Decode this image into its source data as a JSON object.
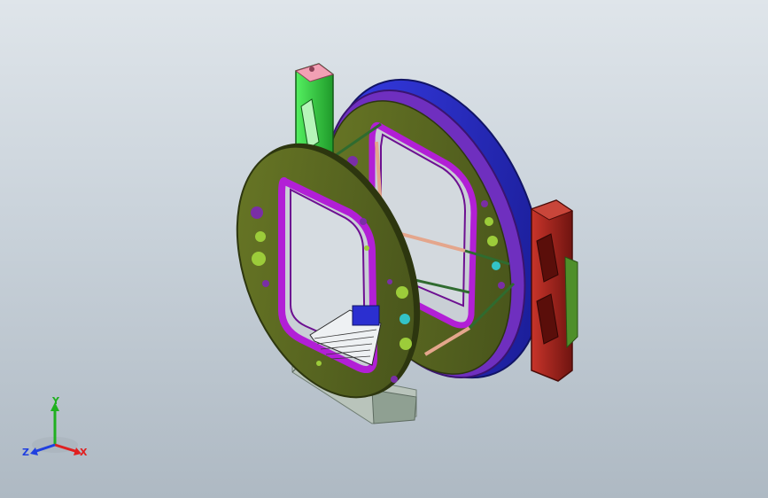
{
  "viewport": {
    "background_top": "#dfe5ea",
    "background_bottom": "#aeb9c3"
  },
  "model": {
    "colors": {
      "ring_face": "#5c6a1f",
      "ring_face_dark": "#3f4a12",
      "window_frame": "#b21fd6",
      "window_frame_dark": "#6d1091",
      "back_ring": "#2b2fd0",
      "back_ring_edge": "#1a1c8a",
      "left_support": "#3ee04a",
      "left_support_dark": "#1f8f2a",
      "right_support": "#b0261e",
      "right_support_dark": "#6a140f",
      "tie_rod": "#e4a68c",
      "tie_rod_dark": "#2f6b2f",
      "bolt_hole_purple": "#7a2ea6",
      "bolt_hole_green": "#9ccc3a",
      "bolt_hole_cyan": "#33c3c8",
      "base_stand": "#9fb0a0",
      "top_cap": "#f2a0b4"
    }
  },
  "triad": {
    "x_label": "X",
    "y_label": "Y",
    "z_label": "Z",
    "x_color": "#e02020",
    "y_color": "#20b020",
    "z_color": "#2040e0"
  }
}
